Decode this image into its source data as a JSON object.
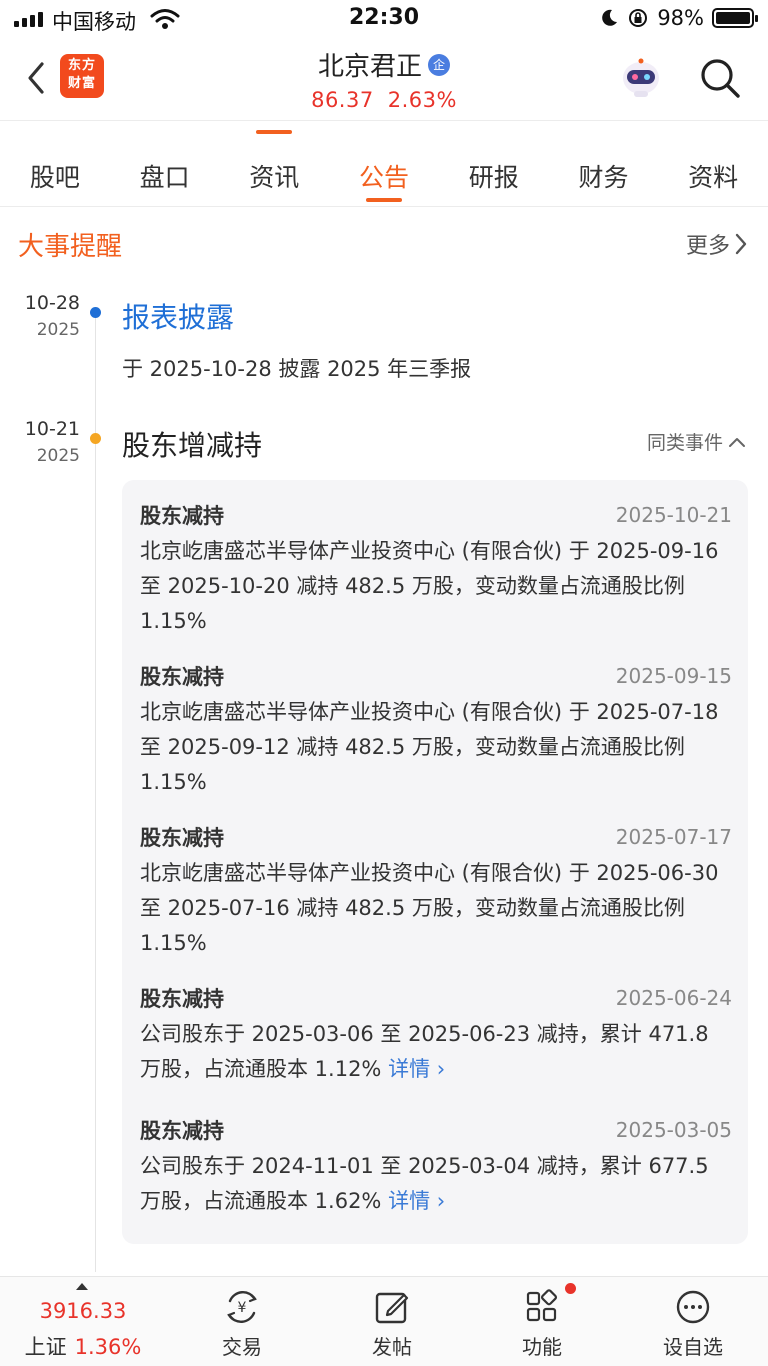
{
  "status_bar": {
    "carrier": "中国移动",
    "time": "22:30",
    "battery": "98%"
  },
  "header": {
    "logo_line1": "东方",
    "logo_line2": "财富",
    "title": "北京君正",
    "badge": "企",
    "price": "86.37",
    "change": "2.63%"
  },
  "tabs": [
    {
      "label": "股吧",
      "active": false
    },
    {
      "label": "盘口",
      "active": false
    },
    {
      "label": "资讯",
      "active": false
    },
    {
      "label": "公告",
      "active": true
    },
    {
      "label": "研报",
      "active": false
    },
    {
      "label": "财务",
      "active": false
    },
    {
      "label": "资料",
      "active": false
    }
  ],
  "section": {
    "title": "大事提醒",
    "more": "更多"
  },
  "events": [
    {
      "date_md": "10-28",
      "year": "2025",
      "title": "报表披露",
      "desc": "于 2025-10-28 披露 2025 年三季报"
    },
    {
      "date_md": "10-21",
      "year": "2025",
      "title": "股东增减持",
      "similar": "同类事件"
    }
  ],
  "details": [
    {
      "title": "股东减持",
      "date": "2025-10-21",
      "body": "北京屹唐盛芯半导体产业投资中心 (有限合伙) 于 2025-09-16 至 2025-10-20 减持 482.5 万股，变动数量占流通股比例 1.15%"
    },
    {
      "title": "股东减持",
      "date": "2025-09-15",
      "body": "北京屹唐盛芯半导体产业投资中心 (有限合伙) 于 2025-07-18 至 2025-09-12 减持 482.5 万股，变动数量占流通股比例 1.15%"
    },
    {
      "title": "股东减持",
      "date": "2025-07-17",
      "body": "北京屹唐盛芯半导体产业投资中心 (有限合伙) 于 2025-06-30 至 2025-07-16 减持 482.5 万股，变动数量占流通股比例 1.15%"
    },
    {
      "title": "股东减持",
      "date": "2025-06-24",
      "body": "公司股东于 2025-03-06 至 2025-06-23 减持，累计 471.8 万股，占流通股本 1.12%",
      "link": "详情"
    },
    {
      "title": "股东减持",
      "date": "2025-03-05",
      "body": "公司股东于 2024-11-01 至 2025-03-04 减持，累计 677.5 万股，占流通股本 1.62%",
      "link": "详情"
    }
  ],
  "bottom_bar": {
    "index_value": "3916.33",
    "index_name": "上证",
    "index_change": "1.36%",
    "items": [
      {
        "label": "交易",
        "icon": "trade-icon"
      },
      {
        "label": "发帖",
        "icon": "compose-icon"
      },
      {
        "label": "功能",
        "icon": "apps-icon"
      },
      {
        "label": "设自选",
        "icon": "more-icon"
      }
    ]
  },
  "colors": {
    "accent": "#f2601f",
    "up_red": "#e8332a",
    "link_blue": "#3a7ad6",
    "event_blue": "#1f6fd6"
  }
}
